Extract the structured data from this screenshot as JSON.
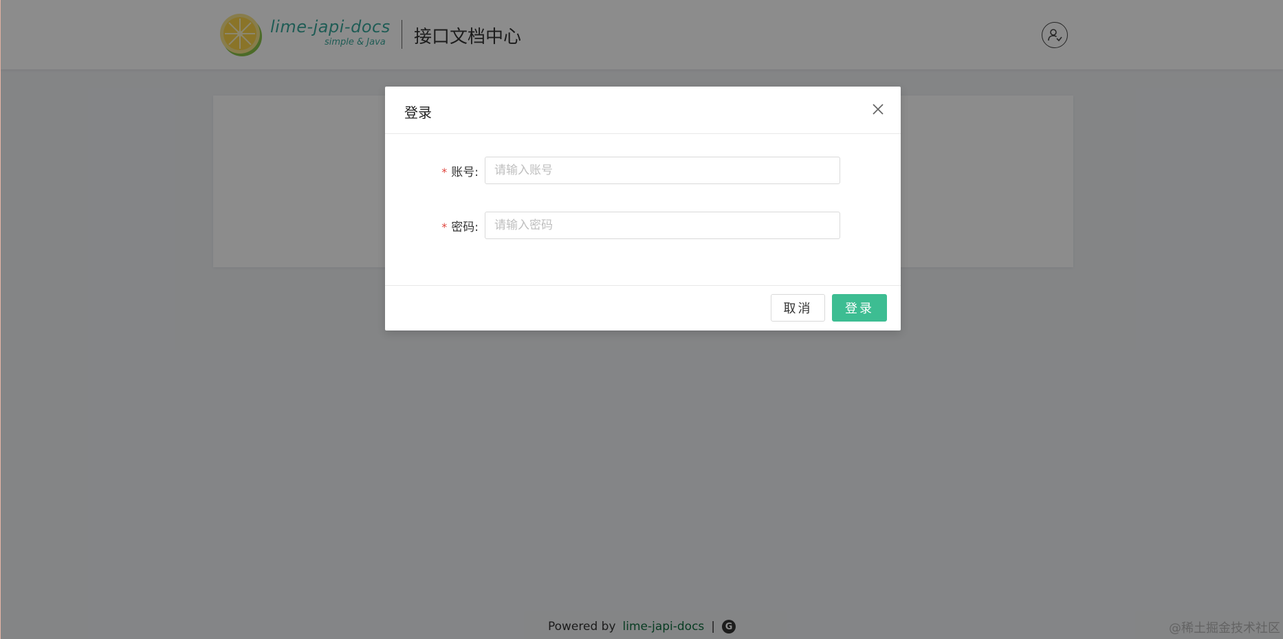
{
  "header": {
    "brand_name": "lime-japi-docs",
    "brand_sub": "simple & Java",
    "site_title": "接口文档中心"
  },
  "modal": {
    "title": "登录",
    "fields": [
      {
        "label": "账号:",
        "placeholder": "请输入账号",
        "value": ""
      },
      {
        "label": "密码:",
        "placeholder": "请输入密码",
        "value": ""
      }
    ],
    "required_mark": "*",
    "cancel_label": "取消",
    "submit_label": "登录"
  },
  "footer": {
    "powered_by": "Powered by",
    "link_text": "lime-japi-docs",
    "separator": "|",
    "icon_letter": "G"
  },
  "watermark": "@稀土掘金技术社区",
  "colors": {
    "brand": "#3aa89b",
    "primary_button": "#3dbd92",
    "required": "#e0453e",
    "footer_link": "#0f6e3e"
  },
  "icons": {
    "logo": "lemon-logo-icon",
    "user": "user-login-icon",
    "close": "close-icon",
    "footer": "g-circle-icon"
  }
}
